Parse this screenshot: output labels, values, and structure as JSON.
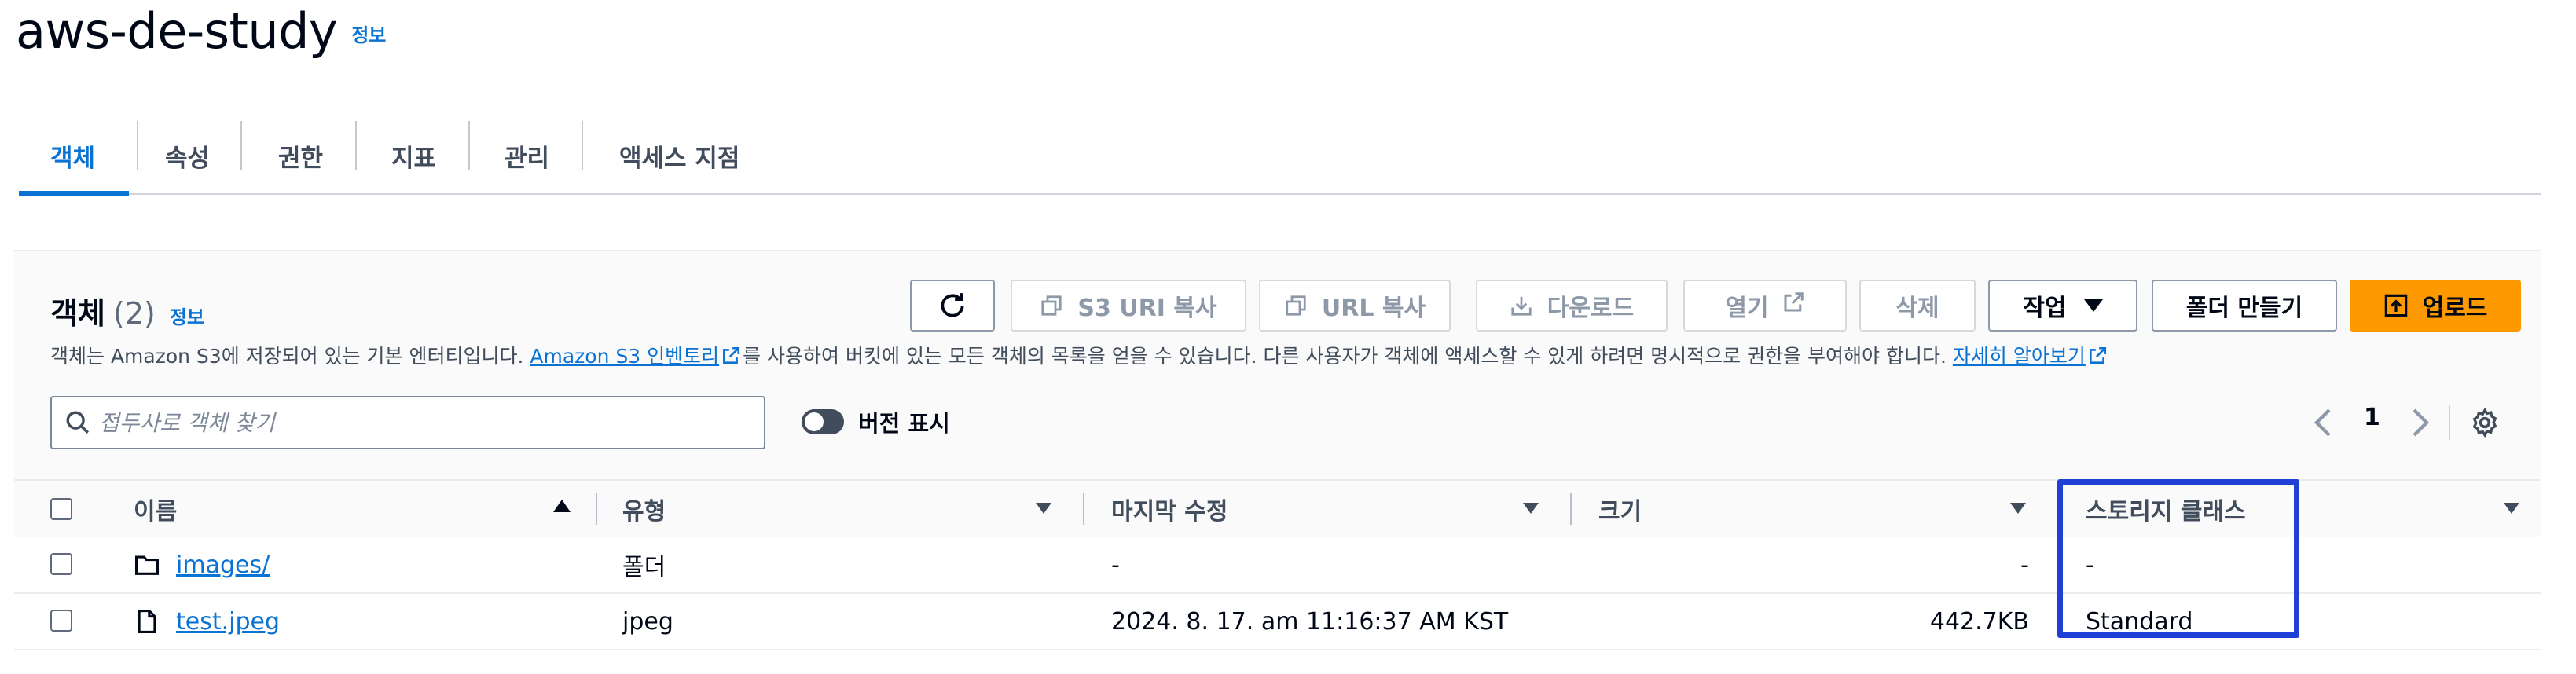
{
  "header": {
    "bucket_name": "aws-de-study",
    "info_label": "정보"
  },
  "tabs": [
    {
      "label": "객체"
    },
    {
      "label": "속성"
    },
    {
      "label": "권한"
    },
    {
      "label": "지표"
    },
    {
      "label": "관리"
    },
    {
      "label": "액세스 지점"
    }
  ],
  "objects": {
    "heading": "객체",
    "count": "(2)",
    "info_label": "정보",
    "description_pre": "객체는 Amazon S3에 저장되어 있는 기본 엔터티입니다. ",
    "inventory_link": "Amazon S3 인벤토리",
    "description_mid": "를 사용하여 버킷에 있는 모든 객체의 목록을 얻을 수 있습니다. 다른 사용자가 객체에 액세스할 수 있게 하려면 명시적으로 권한을 부여해야 합니다. ",
    "learn_more_link": "자세히 알아보기"
  },
  "toolbar": {
    "copy_s3_uri": "S3 URI 복사",
    "copy_url": "URL 복사",
    "download": "다운로드",
    "open": "열기",
    "delete": "삭제",
    "actions": "작업",
    "create_folder": "폴더 만들기",
    "upload": "업로드"
  },
  "search": {
    "placeholder": "접두사로 객체 찾기"
  },
  "versions_toggle": {
    "label": "버전 표시"
  },
  "pagination": {
    "page": "1"
  },
  "table": {
    "columns": [
      "이름",
      "유형",
      "마지막 수정",
      "크기",
      "스토리지 클래스"
    ],
    "rows": [
      {
        "name": "images/",
        "type": "폴더",
        "modified": "-",
        "size": "-",
        "storage_class": "-"
      },
      {
        "name": "test.jpeg",
        "type": "jpeg",
        "modified": "2024. 8. 17. am 11:16:37 AM KST",
        "size": "442.7KB",
        "storage_class": "Standard"
      }
    ]
  },
  "colors": {
    "link": "#0972d3",
    "primary": "#ff9900",
    "highlight": "#1f3fd6"
  }
}
